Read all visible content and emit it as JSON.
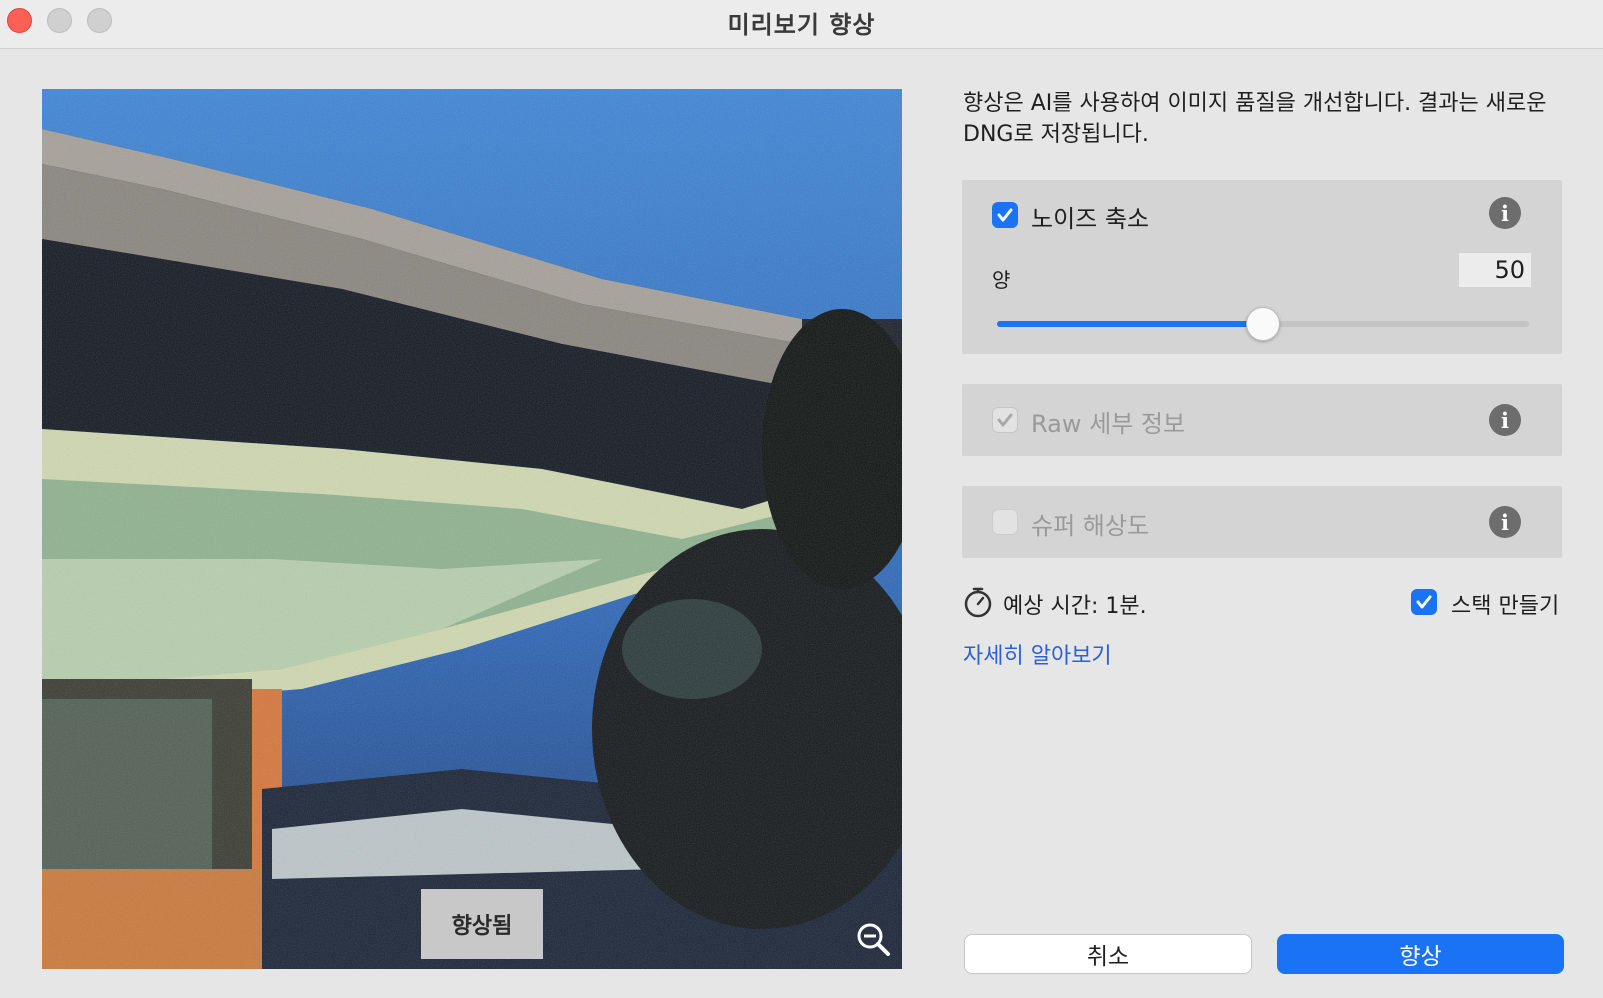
{
  "window": {
    "title": "미리보기 향상"
  },
  "preview": {
    "badge": "향상됨",
    "zoom_icon": "zoom-out-icon"
  },
  "description": "향상은 AI를 사용하여 이미지 품질을 개선합니다. 결과는 새로운 DNG로 저장됩니다.",
  "options": {
    "noise": {
      "label": "노이즈 축소",
      "checked": true,
      "amount_label": "양",
      "amount_value": "50",
      "amount_fraction": 0.5
    },
    "raw": {
      "label": "Raw 세부 정보",
      "checked": true,
      "disabled": true
    },
    "super": {
      "label": "슈퍼 해상도",
      "checked": false,
      "disabled": true
    }
  },
  "estimate": {
    "text": "예상 시간: 1분.",
    "icon": "stopwatch-icon"
  },
  "stack": {
    "label": "스택 만들기",
    "checked": true
  },
  "learn_more": "자세히 알아보기",
  "buttons": {
    "cancel": "취소",
    "enhance": "향상"
  },
  "colors": {
    "accent": "#1a73f4",
    "link": "#2a62d6",
    "close": "#fe5f57"
  }
}
